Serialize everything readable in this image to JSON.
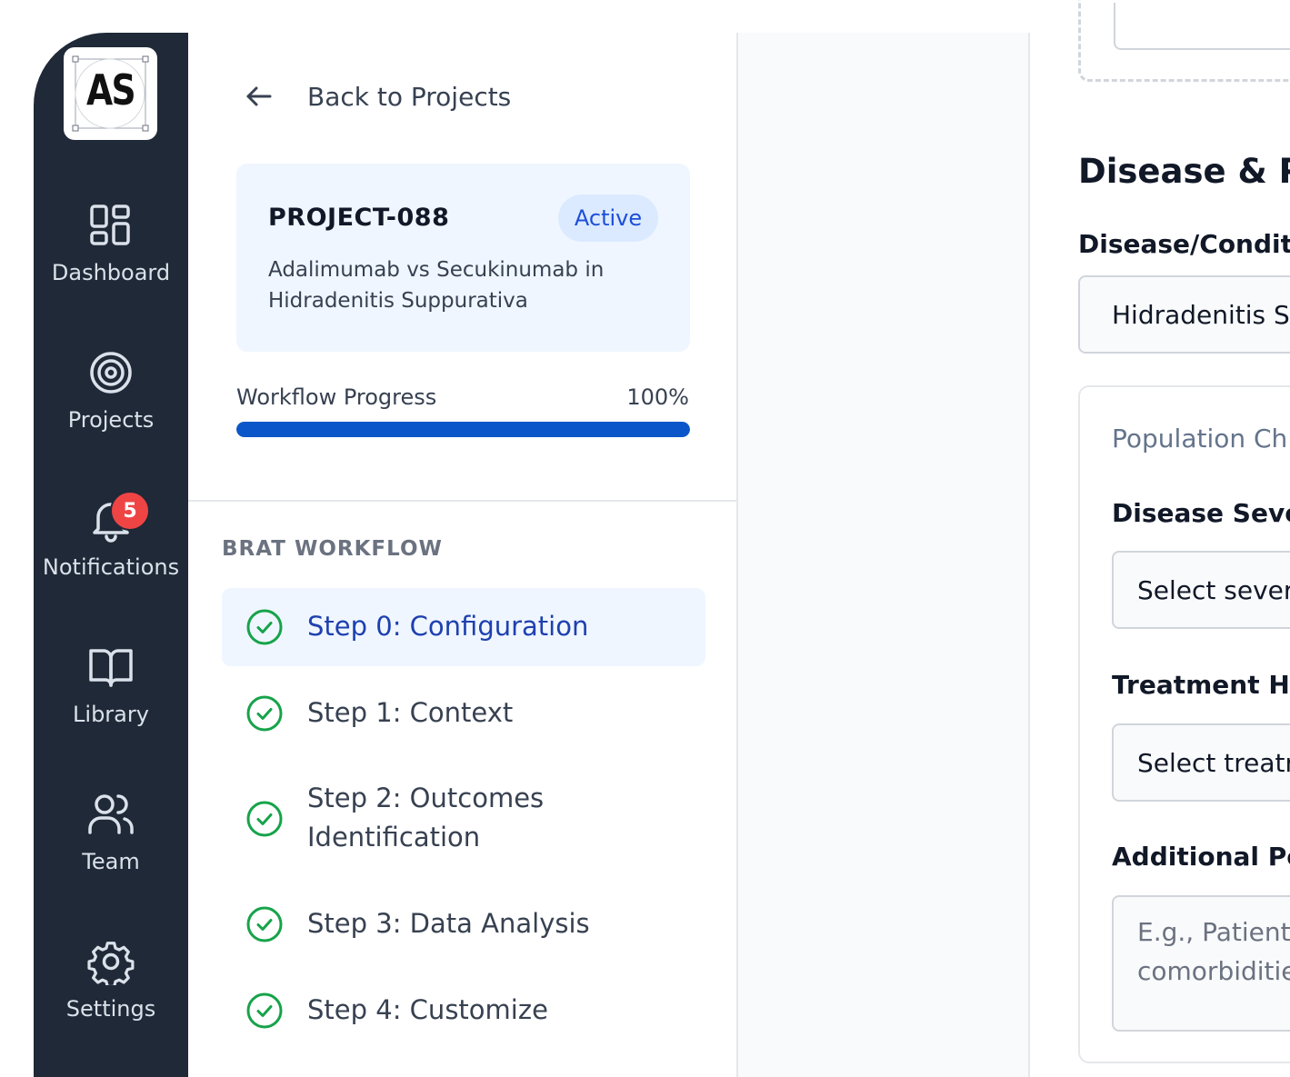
{
  "brand": {
    "logo_text": "AS"
  },
  "nav": [
    {
      "label": "Dashboard",
      "icon": "dashboard-icon"
    },
    {
      "label": "Projects",
      "icon": "target-icon"
    },
    {
      "label": "Notifications",
      "icon": "bell-icon",
      "badge": "5"
    },
    {
      "label": "Library",
      "icon": "book-icon"
    },
    {
      "label": "Team",
      "icon": "users-icon"
    },
    {
      "label": "Settings",
      "icon": "gear-icon"
    }
  ],
  "sidebar": {
    "back_label": "Back to Projects",
    "project": {
      "id": "PROJECT-088",
      "status": "Active",
      "description": "Adalimumab vs Secukinumab in Hidradenitis Suppurativa"
    },
    "progress": {
      "label": "Workflow Progress",
      "percent_text": "100%",
      "value": 1.0
    },
    "section_title": "BRAT WORKFLOW",
    "steps": [
      {
        "label": "Step 0: Configuration",
        "status": "complete",
        "active": true
      },
      {
        "label": "Step 1: Context",
        "status": "complete",
        "active": false
      },
      {
        "label": "Step 2: Outcomes Identification",
        "status": "complete",
        "active": false
      },
      {
        "label": "Step 3: Data Analysis",
        "status": "complete",
        "active": false
      },
      {
        "label": "Step 4: Customize",
        "status": "complete",
        "active": false
      }
    ]
  },
  "main": {
    "section_heading": "Disease & Po",
    "disease_label": "Disease/Conditic",
    "disease_value": "Hidradenitis S",
    "population_card": {
      "title": "Population Ch",
      "severity_label": "Disease Sever",
      "severity_placeholder": "Select sever",
      "treatment_label": "Treatment His",
      "treatment_placeholder": "Select treatr",
      "additional_label": "Additional Pop",
      "additional_placeholder": "E.g., Patients\ncomorbiditie"
    }
  },
  "colors": {
    "rail_bg": "#1f2937",
    "accent": "#0b57c9",
    "active_text": "#1e40af",
    "success": "#16a34a",
    "badge": "#ef4444"
  }
}
